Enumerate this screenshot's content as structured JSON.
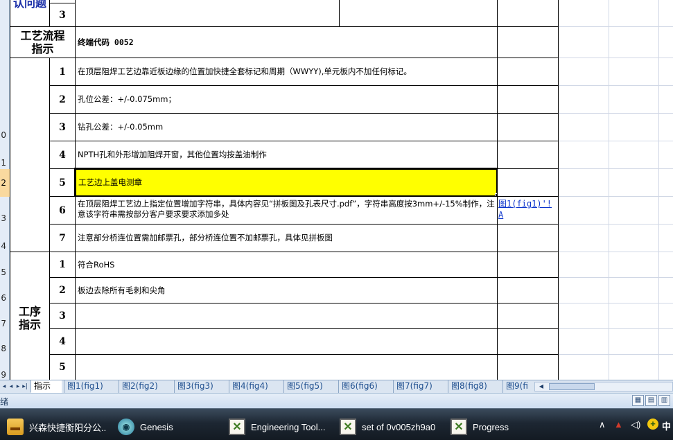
{
  "sheet": {
    "top_partial": {
      "section_label": "认问题",
      "row_num": "3"
    },
    "header": {
      "section_label": "工艺流程\n指示",
      "code_text": "终端代码 0052"
    },
    "process_rows": [
      {
        "num": "1",
        "text": "在顶层阻焊工艺边靠近板边缘的位置加快捷全套标记和周期（WWYY),单元板内不加任何标记。"
      },
      {
        "num": "2",
        "text": "孔位公差：+/-0.075mm；"
      },
      {
        "num": "3",
        "text": "钻孔公差：+/-0.05mm"
      },
      {
        "num": "4",
        "text": "NPTH孔和外形增加阻焊开窗，其他位置均按盖油制作"
      },
      {
        "num": "5",
        "text": "工艺边上盖电测章"
      },
      {
        "num": "6",
        "text": "在顶层阻焊工艺边上指定位置增加字符串，具体内容见“拼板图及孔表尺寸.pdf”，字符串高度按3mm+/-15%制作，注意该字符串需按部分客户要求要求添加多处",
        "link": "图1(fig1)'!A"
      },
      {
        "num": "7",
        "text": "注意部分桥连位置需加邮票孔，部分桥连位置不加邮票孔，具体见拼板图"
      }
    ],
    "operation_section_label": "工序\n指示",
    "operation_rows": [
      {
        "num": "1",
        "text": "符合RoHS"
      },
      {
        "num": "2",
        "text": "板边去除所有毛刺和尖角"
      },
      {
        "num": "3",
        "text": ""
      },
      {
        "num": "4",
        "text": ""
      },
      {
        "num": "5",
        "text": ""
      }
    ],
    "row_headers": [
      "",
      "",
      "",
      "",
      "0",
      "1",
      "2",
      "3",
      "4",
      "5",
      "6",
      "7",
      "8",
      "9"
    ],
    "selected_row_header": "2",
    "selected_fill_color": "#ffff00"
  },
  "tabs": [
    "指示",
    "图1(fig1)",
    "图2(fig2)",
    "图3(fig3)",
    "图4(fig4)",
    "图5(fig5)",
    "图6(fig6)",
    "图7(fig7)",
    "图8(fig8)",
    "图9(fi"
  ],
  "active_tab_index": 0,
  "status": {
    "text": "绪"
  },
  "taskbar": {
    "buttons": [
      {
        "label": "兴森快捷衡阳分公...",
        "icon": "folder-icon"
      },
      {
        "label": "Genesis",
        "icon": "genesis-icon"
      },
      {
        "label": "Engineering Tool...",
        "icon": "x-window-icon"
      },
      {
        "label": "set of 0v005zh9a0",
        "icon": "x-window-icon"
      },
      {
        "label": "Progress",
        "icon": "x-window-icon"
      }
    ],
    "tray_lang": "中"
  }
}
